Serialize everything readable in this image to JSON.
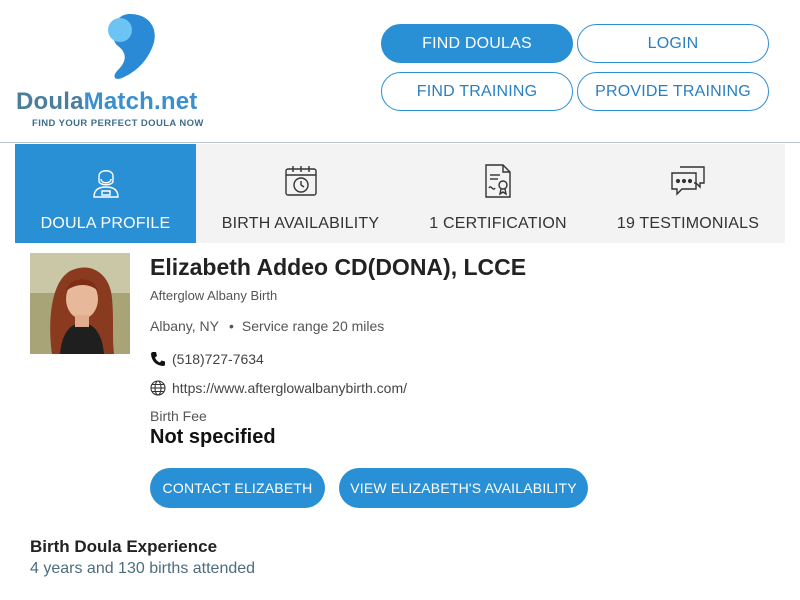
{
  "brand": {
    "name_part1": "Doula",
    "name_part2": "Match.net",
    "tagline": "FIND YOUR PERFECT DOULA NOW",
    "colors": {
      "primary": "#2a90d5",
      "logo_light": "#5ab8f0",
      "logo_dark": "#2a8ad6"
    }
  },
  "nav": {
    "find_doulas": "FIND DOULAS",
    "login": "LOGIN",
    "find_training": "FIND TRAINING",
    "provide_training": "PROVIDE TRAINING"
  },
  "tabs": [
    {
      "label": "DOULA PROFILE",
      "icon": "person-icon",
      "active": true
    },
    {
      "label": "BIRTH AVAILABILITY",
      "icon": "calendar-clock-icon",
      "active": false
    },
    {
      "label": "1 CERTIFICATION",
      "icon": "certificate-icon",
      "active": false
    },
    {
      "label": "19 TESTIMONIALS",
      "icon": "chat-bubbles-icon",
      "active": false
    }
  ],
  "profile": {
    "name": "Elizabeth Addeo CD(DONA), LCCE",
    "business": "Afterglow Albany Birth",
    "location": "Albany, NY",
    "service_range": "Service range 20 miles",
    "phone": "(518)727-7634",
    "website": "https://www.afterglowalbanybirth.com/",
    "fee_label": "Birth Fee",
    "fee_value": "Not specified"
  },
  "actions": {
    "contact": "CONTACT ELIZABETH",
    "availability": "VIEW ELIZABETH'S AVAILABILITY"
  },
  "experience": {
    "title": "Birth Doula Experience",
    "value": "4 years and 130 births attended"
  }
}
